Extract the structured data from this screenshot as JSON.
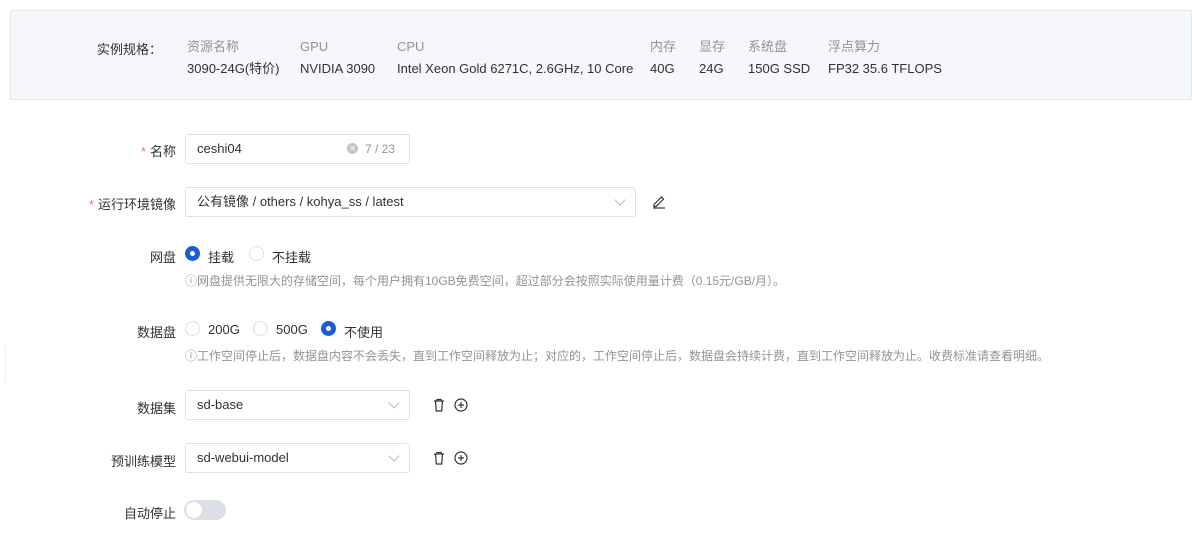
{
  "spec": {
    "title": "实例规格：",
    "columns": [
      {
        "header": "资源名称",
        "value": "3090-24G(特价)"
      },
      {
        "header": "GPU",
        "value": "NVIDIA 3090"
      },
      {
        "header": "CPU",
        "value": "Intel Xeon Gold 6271C, 2.6GHz, 10 Core"
      },
      {
        "header": "内存",
        "value": "40G"
      },
      {
        "header": "显存",
        "value": "24G"
      },
      {
        "header": "系统盘",
        "value": "150G SSD"
      },
      {
        "header": "浮点算力",
        "value": "FP32 35.6 TFLOPS"
      }
    ]
  },
  "form": {
    "name": {
      "label": "名称",
      "required_mark": "*",
      "value": "ceshi04",
      "counter": "7 / 23"
    },
    "image": {
      "label": "运行环境镜像",
      "required_mark": "*",
      "value": "公有镜像 / others / kohya_ss / latest"
    },
    "netdisk": {
      "label": "网盘",
      "options": [
        "挂载",
        "不挂载"
      ],
      "selected": "挂载",
      "hint": "ⓘ网盘提供无限大的存储空间，每个用户拥有10GB免费空间，超过部分会按照实际使用量计费（0.15元/GB/月）。"
    },
    "datadisk": {
      "label": "数据盘",
      "options": [
        "200G",
        "500G",
        "不使用"
      ],
      "selected": "不使用",
      "hint": "ⓘ工作空间停止后，数据盘内容不会丢失，直到工作空间释放为止；对应的，工作空间停止后，数据盘会持续计费，直到工作空间释放为止。收费标准请查看明细。"
    },
    "dataset": {
      "label": "数据集",
      "value": "sd-base"
    },
    "pretrained": {
      "label": "预训练模型",
      "value": "sd-webui-model"
    },
    "autostop": {
      "label": "自动停止",
      "enabled": false
    }
  },
  "colors": {
    "primary": "#1a5fd1",
    "required": "#f56c6c",
    "muted": "#909399"
  }
}
